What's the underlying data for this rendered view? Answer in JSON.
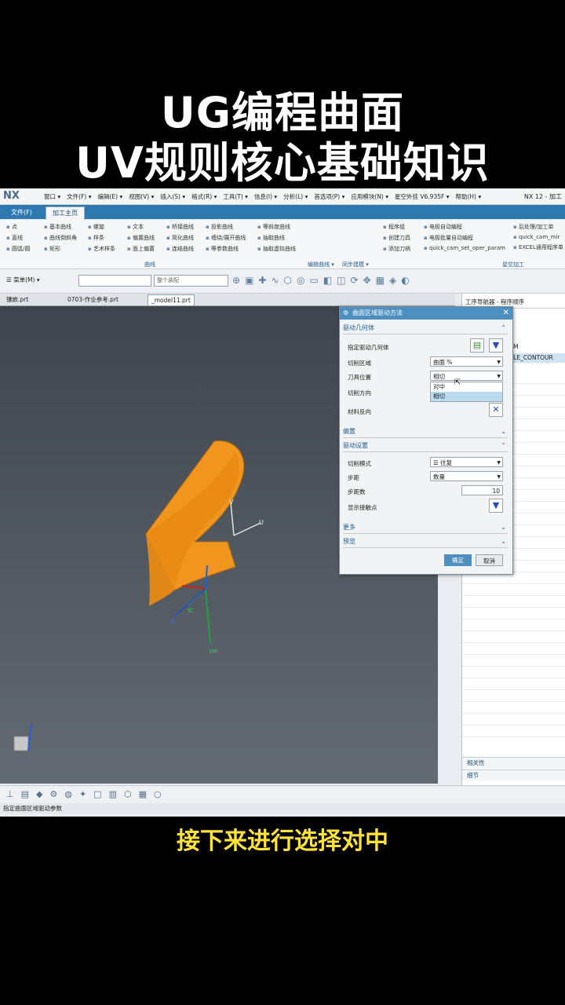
{
  "overlay": {
    "title_line1": "UG编程曲面",
    "title_line2": "UV规则核心基础知识",
    "subtitle": "接下来进行选择对中"
  },
  "app": {
    "logo": "NX",
    "menu": [
      "窗口 ▾",
      "文件(F) ▾",
      "编辑(E) ▾",
      "视图(V) ▾",
      "插入(S) ▾",
      "格式(R) ▾",
      "工具(T) ▾",
      "信息(I) ▾",
      "分析(L) ▾",
      "首选项(P) ▾",
      "应用模块(N) ▾",
      "星空外挂 V6.935F ▾",
      "帮助(H) ▾"
    ],
    "version": "NX 12 - 加工"
  },
  "ribbon": {
    "tabs": [
      "文件(F)",
      "加工主页"
    ],
    "col1": [
      "点",
      "直线",
      "圆弧/圆"
    ],
    "col2": [
      "基本曲线",
      "曲线倒斜角",
      "矩形"
    ],
    "col3": [
      "螺旋",
      "样条",
      "艺术样条"
    ],
    "col4": [
      "文本",
      "偏置曲线",
      "面上偏置"
    ],
    "col5": [
      "桥接曲线",
      "简化曲线",
      "连结曲线"
    ],
    "col6": [
      "投影曲线",
      "缠绕/展开曲线",
      "等参数曲线"
    ],
    "col7": [
      "等斜度曲线",
      "抽取曲线",
      "抽取虚拟曲线"
    ],
    "col8": [
      "程序组",
      "创建刀具",
      "添加刀柄"
    ],
    "col9": [
      "电极自动编程",
      "电极批量自动编程",
      "quick_cam_set_oper_param"
    ],
    "col10": [
      "后处理/加工单",
      "quick_cam_mir",
      "EXCEL通用程序单"
    ],
    "groups": [
      "曲线",
      "编辑曲线 ▾",
      "同步建模 ▾",
      "星空加工"
    ]
  },
  "toolbar": {
    "menu_label": "菜单(M) ▾",
    "combo1": "",
    "combo2": "整个装配"
  },
  "doc_tabs": [
    "镶嵌.prt",
    "0703-作业参考.prt",
    "_model11.prt"
  ],
  "navigator": {
    "header": "工序导航器 - 程序顺序",
    "row1": "AM",
    "row2": "BLE_CONTOUR",
    "sections": [
      "相关性",
      "细节"
    ]
  },
  "dialog": {
    "title": "曲面区域驱动方法",
    "section_geometry": "驱动几何体",
    "specify_geometry": "指定驱动几何体",
    "cut_area_label": "切削区域",
    "cut_area_value": "曲面 %",
    "tool_position_label": "刀具位置",
    "tool_position_value": "相切",
    "tool_position_options": [
      "对中",
      "相切"
    ],
    "cut_direction_label": "切削方向",
    "material_reverse_label": "材料反向",
    "section_offset": "偏置",
    "section_drive": "驱动设置",
    "cut_mode_label": "切削模式",
    "cut_mode_value": "往复",
    "stepover_label": "步距",
    "stepover_value": "数量",
    "step_count_label": "步距数",
    "step_count_value": "10",
    "show_contact_label": "显示接触点",
    "section_more": "更多",
    "section_preview": "预览",
    "ok": "确定",
    "cancel": "取消"
  },
  "viewport": {
    "axis_u": "U",
    "axis_v": "V",
    "axis_yc": "YC",
    "axis_xc": "XC",
    "axis_ym": "YM",
    "surface_color": "#f0961e"
  },
  "status": "指定曲面区域驱动参数"
}
